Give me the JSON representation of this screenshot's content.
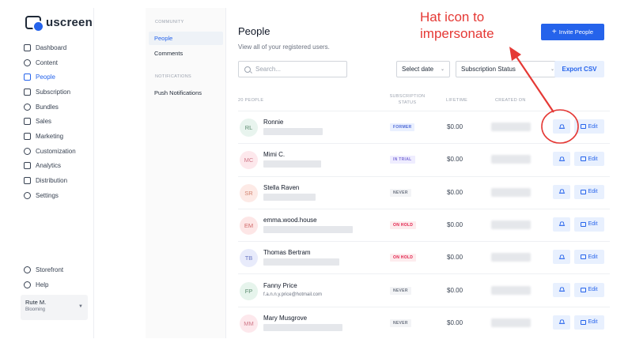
{
  "app": {
    "brand": "uscreen"
  },
  "sidebar": {
    "items": [
      {
        "label": "Dashboard",
        "icon": "dashboard-icon"
      },
      {
        "label": "Content",
        "icon": "folder-icon"
      },
      {
        "label": "People",
        "icon": "people-icon",
        "active": true
      },
      {
        "label": "Subscription",
        "icon": "refresh-icon"
      },
      {
        "label": "Bundles",
        "icon": "box-icon"
      },
      {
        "label": "Sales",
        "icon": "dollar-icon"
      },
      {
        "label": "Marketing",
        "icon": "megaphone-icon"
      },
      {
        "label": "Customization",
        "icon": "pencil-square-icon"
      },
      {
        "label": "Analytics",
        "icon": "chart-icon"
      },
      {
        "label": "Distribution",
        "icon": "devices-icon"
      },
      {
        "label": "Settings",
        "icon": "gear-icon"
      }
    ],
    "bottom_items": [
      {
        "label": "Storefront",
        "icon": "storefront-icon"
      },
      {
        "label": "Help",
        "icon": "help-icon"
      }
    ],
    "user": {
      "name": "Rute M.",
      "plan": "Blooming"
    }
  },
  "subnav": {
    "community_heading": "COMMUNITY",
    "community_items": [
      "People",
      "Comments"
    ],
    "notifications_heading": "NOTIFICATIONS",
    "notifications_items": [
      "Push Notifications"
    ]
  },
  "main": {
    "title": "People",
    "subtitle": "View all of your registered users.",
    "invite_label": "Invite People",
    "search_placeholder": "Search...",
    "select_date": "Select date",
    "subscription_status": "Subscription Status",
    "export_label": "Export CSV",
    "columns": {
      "count": "20 PEOPLE",
      "status_1": "SUBSCRIPTION",
      "status_2": "STATUS",
      "lifetime": "LIFETIME",
      "created": "CREATED ON"
    },
    "edit_label": "Edit",
    "rows": [
      {
        "initials": "RL",
        "name": "Ronnie",
        "email": "",
        "status": "FORMER",
        "lifetime": "$0.00"
      },
      {
        "initials": "MC",
        "name": "Mimi C.",
        "email": "",
        "status": "IN TRIAL",
        "lifetime": "$0.00"
      },
      {
        "initials": "SR",
        "name": "Stella Raven",
        "email": "",
        "status": "NEVER",
        "lifetime": "$0.00"
      },
      {
        "initials": "EM",
        "name": "emma.wood.house",
        "email": "",
        "status": "ON HOLD",
        "lifetime": "$0.00"
      },
      {
        "initials": "TB",
        "name": "Thomas Bertram",
        "email": "",
        "status": "ON HOLD",
        "lifetime": "$0.00"
      },
      {
        "initials": "FP",
        "name": "Fanny Price",
        "email": "f.a.n.n.y.price@hotmail.com",
        "status": "NEVER",
        "lifetime": "$0.00"
      },
      {
        "initials": "MM",
        "name": "Mary Musgrove",
        "email": "",
        "status": "NEVER",
        "lifetime": "$0.00"
      }
    ]
  },
  "annotation": {
    "line1": "Hat icon to",
    "line2": "impersonate"
  },
  "colors": {
    "accent": "#2563eb",
    "annotation_red": "#e53935",
    "badge_former": "#4f6bd6",
    "badge_trial": "#7c6fd6",
    "badge_never": "#6b7280",
    "badge_hold": "#e11d48"
  }
}
